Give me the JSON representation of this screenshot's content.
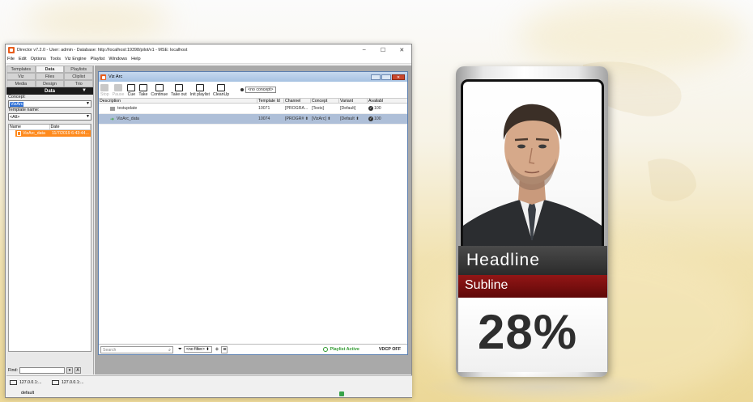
{
  "director": {
    "title": "Director v7.2.0 - User: admin - Database: http://localhost:19398/pilot/v1 - MSE: localhost",
    "window_controls": {
      "minimize": "–",
      "maximize": "☐",
      "close": "✕"
    },
    "menu": [
      "File",
      "Edit",
      "Options",
      "Tools",
      "Viz Engine",
      "Playlist",
      "Windows",
      "Help"
    ]
  },
  "left_panel": {
    "tabs_row1": [
      "Templates",
      "Data",
      "Playlists"
    ],
    "tabs_row2": [
      "Viz",
      "Files",
      "Cliplist"
    ],
    "tabs_row3": [
      "Media",
      "Design",
      "Trio"
    ],
    "header": "Data",
    "concept_label": "Concept:",
    "concept_value": "VizArc",
    "template_label": "Template name:",
    "template_value": "<All>",
    "tree_columns": [
      "Name",
      "Date"
    ],
    "tree_item": {
      "name": "VizArc_data",
      "date": "11/7/2019 6:43:44..."
    },
    "find_label": "Find:"
  },
  "playlist": {
    "title": "Viz Arc",
    "toolbar": [
      "Stop",
      "Pause",
      "Cue",
      "Take",
      "Continue",
      "Take out",
      "Init playlist",
      "CleanUp"
    ],
    "concept": "<no concept>",
    "columns": [
      "Description",
      "Template Id",
      "Channel",
      "Concept",
      "Variant",
      "Availabl"
    ],
    "rows": [
      {
        "description": "testupdate",
        "template_id": "10071",
        "channel": "[PROGRA...",
        "concept": "[Tests]",
        "variant": "[Default]",
        "available": "100"
      },
      {
        "description": "VizArc_data",
        "template_id": "10074",
        "channel": "[PROGR# ⬍",
        "concept": "[VizArc] ⬍",
        "variant": "[Default ⬍",
        "available": "100"
      }
    ],
    "search_placeholder": "Search",
    "filter": "<no filter> ⬍",
    "status": "Playlist Active",
    "vdcp": "VDCP OFF"
  },
  "taskbar": {
    "connections": [
      "127.0.0.1:...",
      "127.0.0.1:..."
    ],
    "status": "default"
  },
  "graphic": {
    "headline": "Headline",
    "subline": "Subline",
    "value": "28%"
  },
  "colors": {
    "accent_orange": "#ff8a1c",
    "selection_blue": "#3173d8",
    "headline_bar": "#333333",
    "subline_bar": "#7a0e0e"
  }
}
